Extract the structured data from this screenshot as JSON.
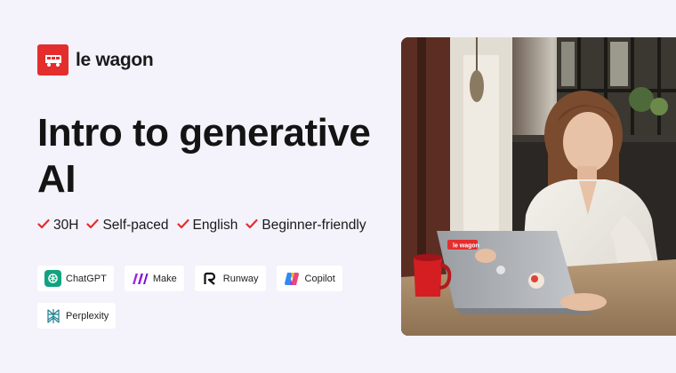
{
  "brand": {
    "name": "le wagon",
    "logo_icon": "wagon-icon",
    "accent": "#e42d2d"
  },
  "course": {
    "title": "Intro to generative AI"
  },
  "features": [
    {
      "label": "30H"
    },
    {
      "label": "Self-paced"
    },
    {
      "label": "English"
    },
    {
      "label": "Beginner-friendly"
    }
  ],
  "tools": [
    {
      "label": "ChatGPT",
      "icon": "chatgpt-icon"
    },
    {
      "label": "Make",
      "icon": "make-icon"
    },
    {
      "label": "Runway",
      "icon": "runway-icon"
    },
    {
      "label": "Copilot",
      "icon": "copilot-icon"
    },
    {
      "label": "Perplexity",
      "icon": "perplexity-icon"
    }
  ],
  "photo": {
    "laptop_sticker": "le wagon"
  },
  "colors": {
    "background": "#f4f2fa",
    "check": "#e42d2d"
  }
}
